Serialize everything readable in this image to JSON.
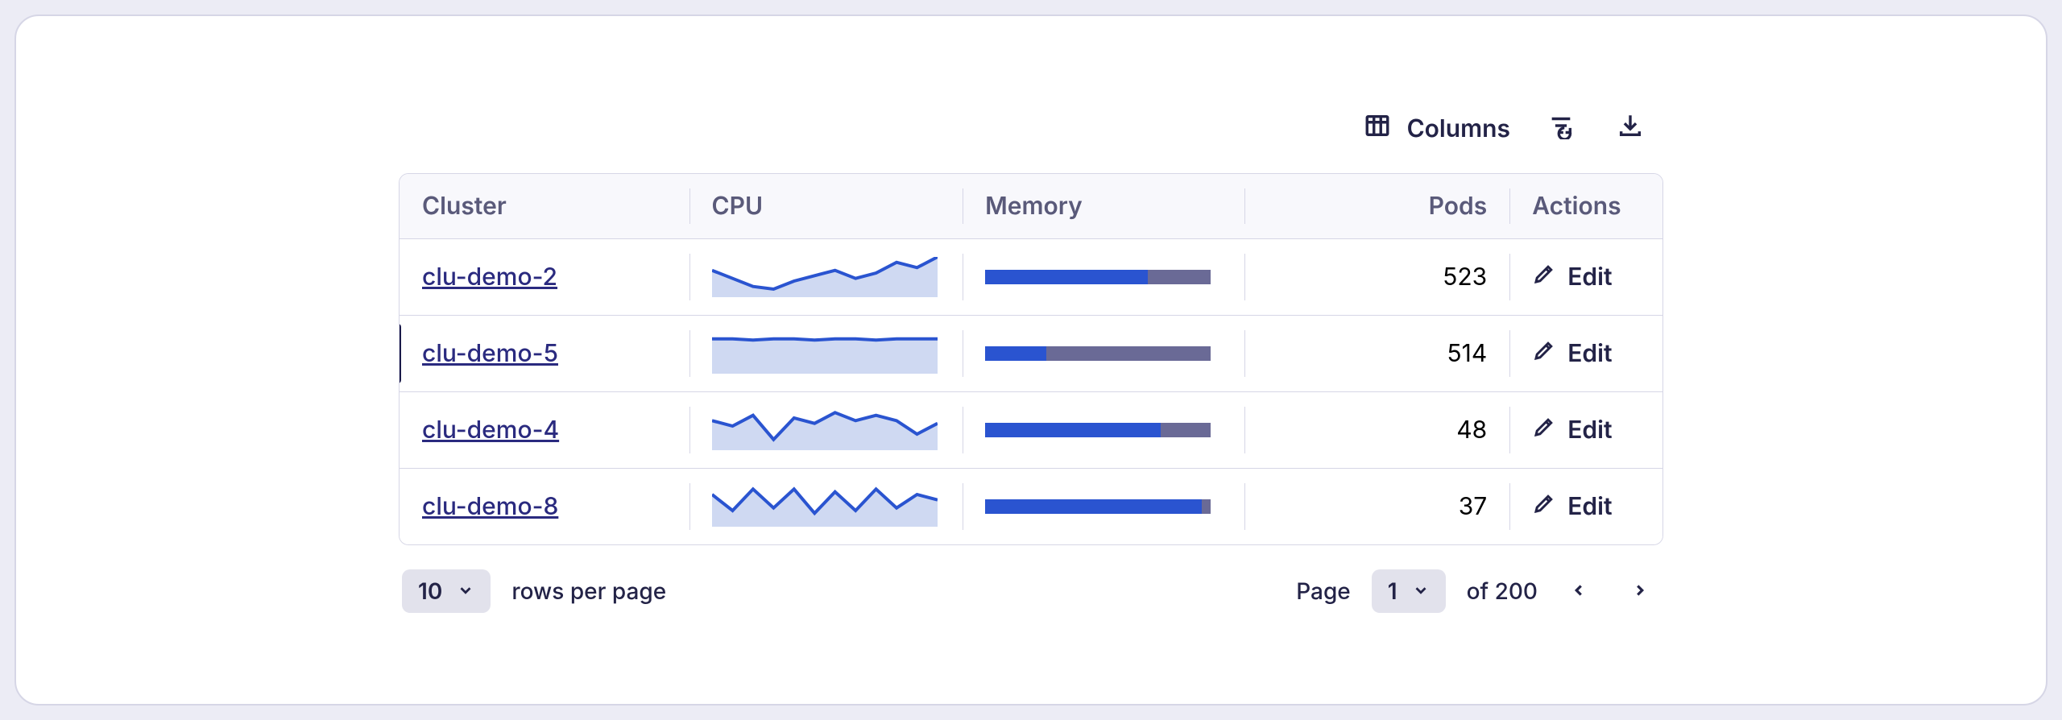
{
  "toolbar": {
    "columns_label": "Columns"
  },
  "columns": {
    "cluster": "Cluster",
    "cpu": "CPU",
    "memory": "Memory",
    "pods": "Pods",
    "actions": "Actions"
  },
  "rows": [
    {
      "cluster": "clu-demo-2",
      "pods": "523",
      "memory_pct": 72,
      "edit_label": "Edit",
      "active": false,
      "cpu_spark": [
        20,
        14,
        8,
        6,
        12,
        16,
        20,
        14,
        18,
        26,
        22,
        30
      ]
    },
    {
      "cluster": "clu-demo-5",
      "pods": "514",
      "memory_pct": 27,
      "edit_label": "Edit",
      "active": true,
      "cpu_spark": [
        26,
        26,
        25,
        26,
        26,
        25,
        26,
        26,
        25,
        26,
        26,
        26
      ]
    },
    {
      "cluster": "clu-demo-4",
      "pods": "48",
      "memory_pct": 78,
      "edit_label": "Edit",
      "active": false,
      "cpu_spark": [
        22,
        18,
        26,
        8,
        24,
        20,
        28,
        22,
        26,
        22,
        12,
        20
      ]
    },
    {
      "cluster": "clu-demo-8",
      "pods": "37",
      "memory_pct": 96,
      "edit_label": "Edit",
      "active": false,
      "cpu_spark": [
        24,
        12,
        28,
        14,
        28,
        10,
        26,
        12,
        28,
        14,
        24,
        20
      ]
    }
  ],
  "pagination": {
    "rows_per_page_value": "10",
    "rows_per_page_label": "rows per page",
    "page_label": "Page",
    "current_page": "1",
    "total_label": "of 200"
  }
}
